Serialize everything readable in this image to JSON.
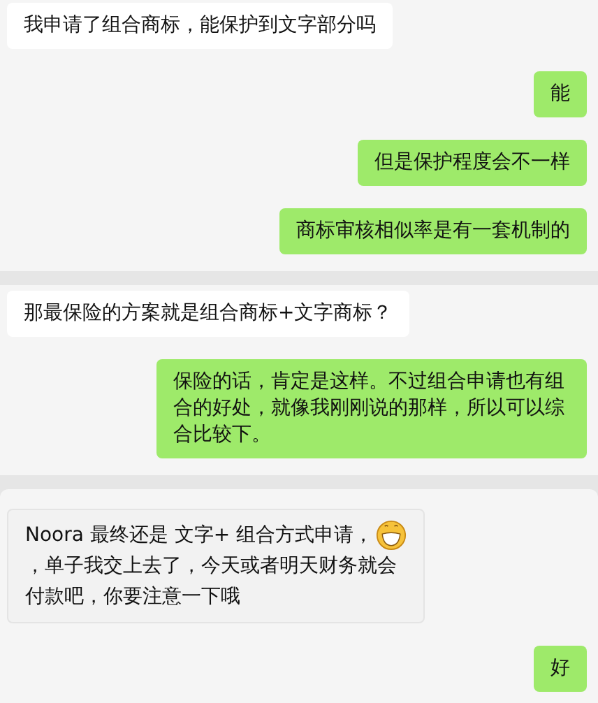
{
  "sections": [
    {
      "messages": [
        {
          "outgoing": false,
          "kind": "plain",
          "text": "我申请了组合商标，能保护到文字部分吗"
        },
        {
          "outgoing": true,
          "kind": "plain",
          "text": "能"
        },
        {
          "outgoing": true,
          "kind": "plain",
          "text": "但是保护程度会不一样"
        },
        {
          "outgoing": true,
          "kind": "plain",
          "text": "商标审核相似率是有一套机制的"
        }
      ]
    },
    {
      "messages": [
        {
          "outgoing": false,
          "kind": "plain",
          "text": "那最保险的方案就是组合商标+文字商标？"
        },
        {
          "outgoing": true,
          "kind": "plain",
          "text": "保险的话，肯定是这样。不过组合申请也有组合的好处，就像我刚刚说的那样，所以可以综合比较下。"
        }
      ]
    },
    {
      "messages": [
        {
          "outgoing": false,
          "kind": "with_emoji",
          "text": "Noora  最终还是 文字+ 组合方式申请，",
          "text_after": "，单子我交上去了，今天或者明天财务就会付款吧，你要注意一下哦"
        },
        {
          "outgoing": true,
          "kind": "plain",
          "text": "好"
        }
      ]
    }
  ]
}
